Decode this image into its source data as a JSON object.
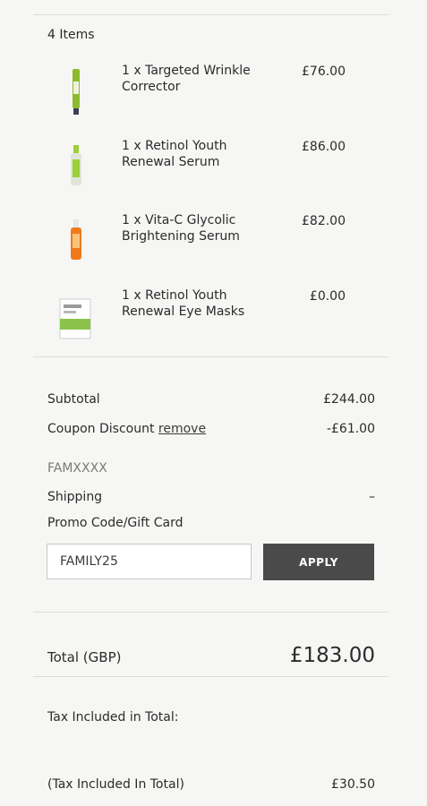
{
  "cart": {
    "items_count": "4 Items",
    "items": [
      {
        "name": "1 x Targeted Wrinkle Corrector",
        "price": "£76.00",
        "icon": "wrinkle-corrector-tube"
      },
      {
        "name": "1 x Retinol Youth Renewal Serum",
        "price": "£86.00",
        "icon": "serum-bottle"
      },
      {
        "name": "1 x Vita-C Glycolic Brightening Serum",
        "price": "£82.00",
        "icon": "vitamin-c-bottle"
      },
      {
        "name": "1 x Retinol Youth Renewal Eye Masks",
        "price": "£0.00",
        "icon": "eye-mask-box"
      }
    ]
  },
  "summary": {
    "subtotal_label": "Subtotal",
    "subtotal_value": "£244.00",
    "coupon_label": "Coupon Discount",
    "coupon_remove": "remove",
    "coupon_value": "-£61.00",
    "coupon_code": "FAMXXXX",
    "shipping_label": "Shipping",
    "shipping_value": "–",
    "promo_label": "Promo Code/Gift Card",
    "promo_value": "FAMILY25",
    "apply_label": "APPLY"
  },
  "total": {
    "label": "Total (GBP)",
    "value": "£183.00"
  },
  "tax": {
    "title": "Tax Included in Total:",
    "line_label": "(Tax Included In Total)",
    "line_value": "£30.50"
  },
  "colors": {
    "background": "#f6f6f4",
    "button": "#4a4a4a",
    "divider": "#dcdcda"
  }
}
